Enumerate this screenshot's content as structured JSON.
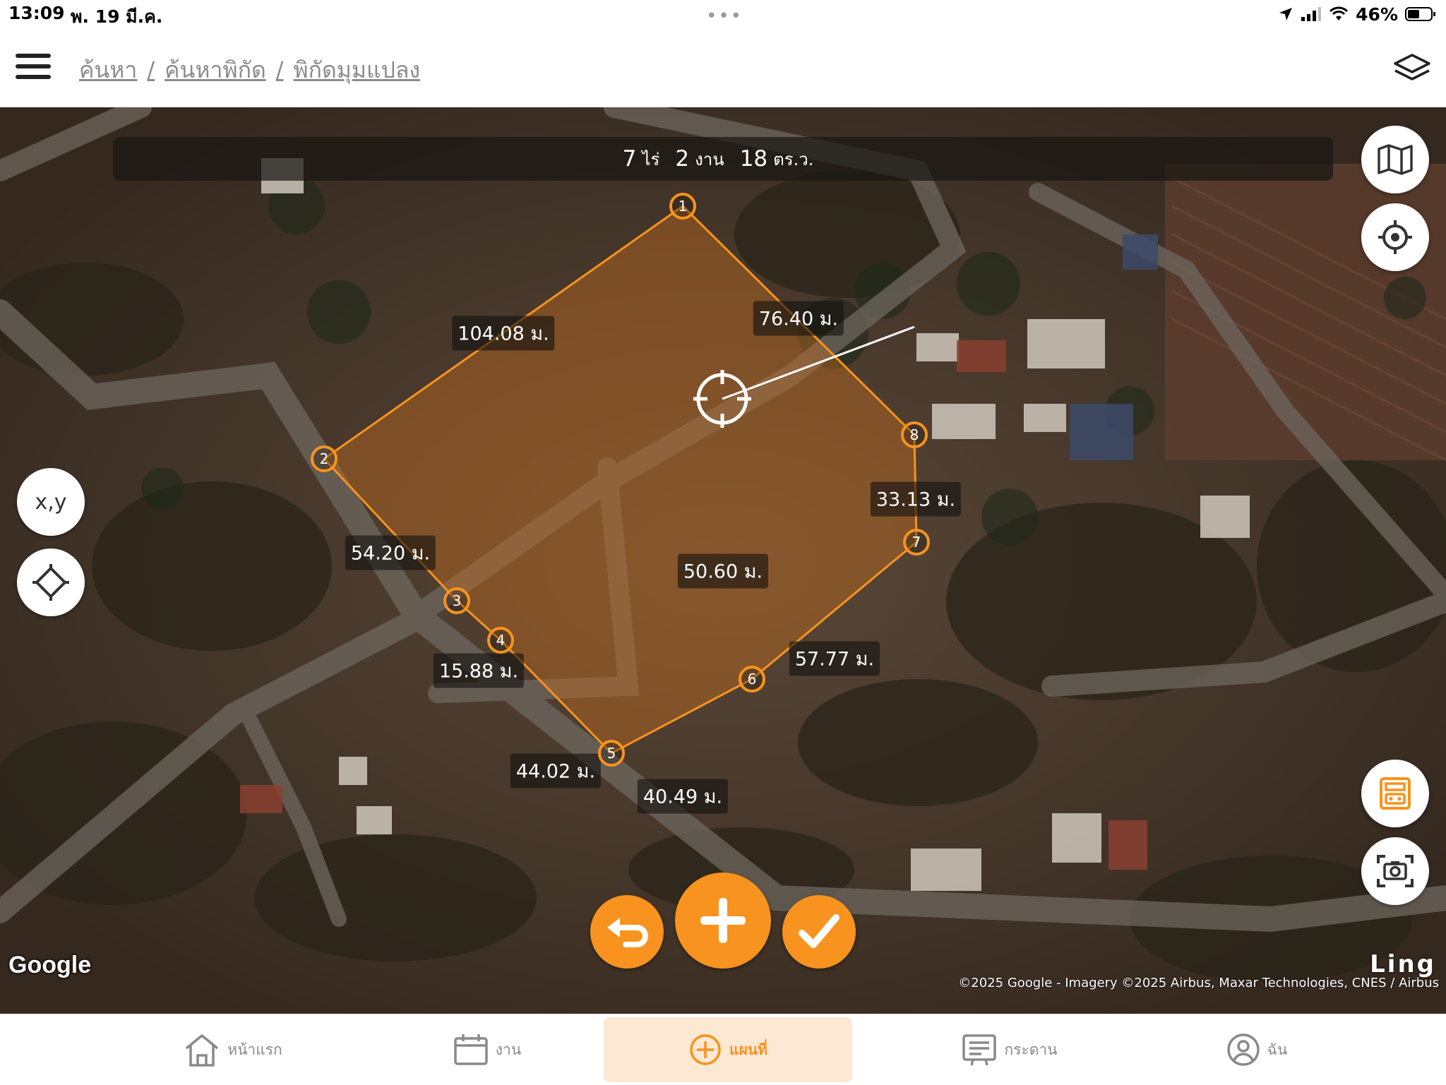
{
  "status_bar": {
    "time": "13:09",
    "date": "พ. 19 มี.ค.",
    "dots": "•••",
    "battery_percent": "46%"
  },
  "header": {
    "breadcrumb": [
      "ค้นหา",
      "ค้นหาพิกัด",
      "พิกัดมุมแปลง"
    ]
  },
  "map": {
    "area": {
      "rai": "7",
      "rai_unit": "ไร่",
      "ngan": "2",
      "ngan_unit": "งาน",
      "wa": "18",
      "wa_unit": "ตร.ว."
    },
    "vertices": [
      "1",
      "2",
      "3",
      "4",
      "5",
      "6",
      "7",
      "8"
    ],
    "edges": {
      "e12": "104.08 ม.",
      "e23": "54.20 ม.",
      "e34": "15.88 ม.",
      "e45": "44.02 ม.",
      "e56": "40.49 ม.",
      "e67": "57.77 ม.",
      "e78": "33.13 ม.",
      "e81": "76.40 ม.",
      "center_distance": "50.60 ม."
    },
    "xy_button": "x,y",
    "google_logo": "Google",
    "brand": "Ling",
    "attribution": "©2025 Google - Imagery ©2025 Airbus, Maxar Technologies, CNES / Airbus"
  },
  "tabs": [
    {
      "label": "หน้าแรก",
      "icon": "home-icon"
    },
    {
      "label": "งาน",
      "icon": "calendar-icon"
    },
    {
      "label": "แผนที่",
      "icon": "add-circle-icon"
    },
    {
      "label": "กระดาน",
      "icon": "board-icon"
    },
    {
      "label": "ฉัน",
      "icon": "user-icon"
    }
  ],
  "colors": {
    "accent": "#f7931e",
    "polygon_fill": "rgba(200,110,30,0.42)"
  }
}
